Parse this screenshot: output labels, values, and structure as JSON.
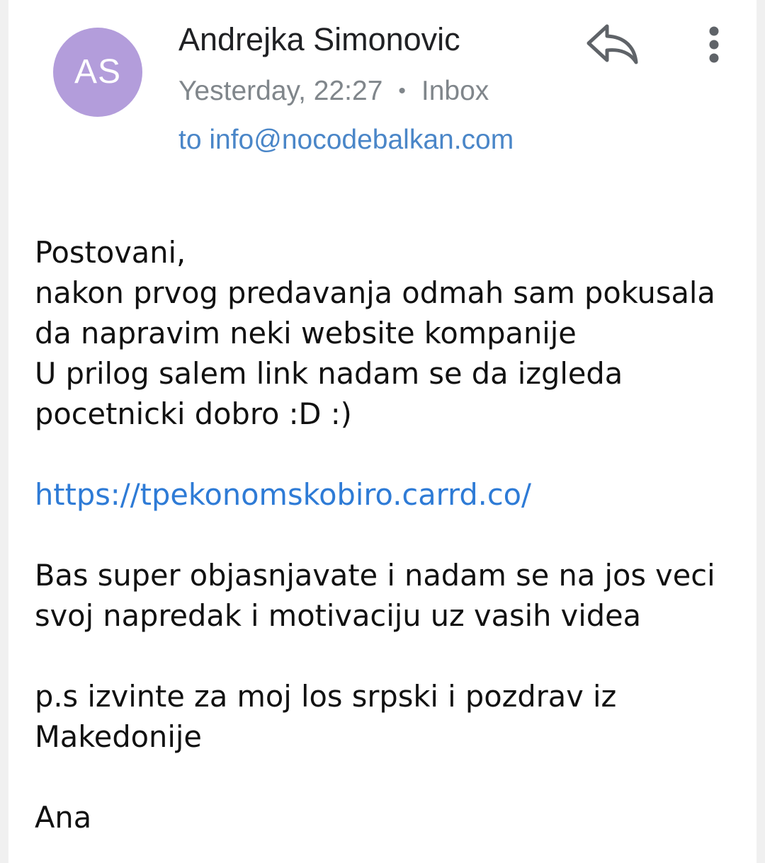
{
  "sender": {
    "initials": "AS",
    "name": "Andrejka Simonovic",
    "avatar_color": "#b39ddb"
  },
  "meta": {
    "time": "Yesterday, 22:27",
    "separator": "•",
    "folder": "Inbox",
    "recipient": "to info@nocodebalkan.com"
  },
  "actions": {
    "reply_icon": "reply-icon",
    "more_icon": "more-vertical-icon"
  },
  "message": {
    "greeting": "Postovani,",
    "para1": [
      "nakon prvog predavanja odmah sam pokusala",
      "da napravim neki website kompanije",
      "U prilog salem link nadam se da izgleda",
      "pocetnicki dobro :D  :)"
    ],
    "link": "https://tpekonomskobiro.carrd.co/",
    "para2": [
      "Bas super objasnjavate i nadam se na jos veci",
      "svoj napredak i motivaciju uz vasih videa"
    ],
    "para3": [
      "p.s izvinte za moj los srpski i pozdrav iz",
      "Makedonije"
    ],
    "signature": "Ana"
  },
  "colors": {
    "link": "#2e7bd6",
    "recipient": "#4a86c8",
    "meta_text": "#80868b",
    "icon": "#5f6368"
  }
}
